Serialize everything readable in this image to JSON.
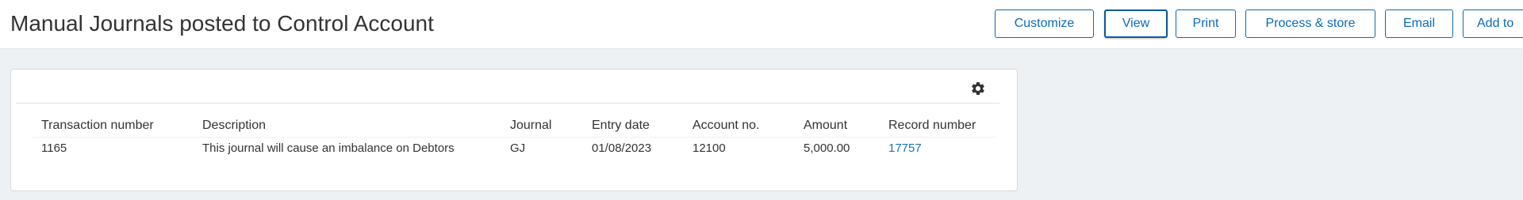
{
  "page": {
    "title": "Manual Journals posted to Control Account"
  },
  "toolbar": {
    "customize_label": "Customize",
    "view_label": "View",
    "print_label": "Print",
    "process_store_label": "Process & store",
    "email_label": "Email",
    "add_to_label": "Add to"
  },
  "settings": {
    "icon": "gear-icon"
  },
  "table": {
    "headers": {
      "transaction_number": "Transaction number",
      "description": "Description",
      "journal": "Journal",
      "entry_date": "Entry date",
      "account_no": "Account no.",
      "amount": "Amount",
      "record_number": "Record number"
    },
    "rows": [
      {
        "transaction_number": "1165",
        "description": "This journal will cause an imbalance on Debtors",
        "journal": "GJ",
        "entry_date": "01/08/2023",
        "account_no": "12100",
        "amount": "5,000.00",
        "record_number": "17757"
      }
    ]
  },
  "colors": {
    "accent": "#0a6bb6",
    "link": "#1874b4",
    "background": "#eef1f3"
  }
}
